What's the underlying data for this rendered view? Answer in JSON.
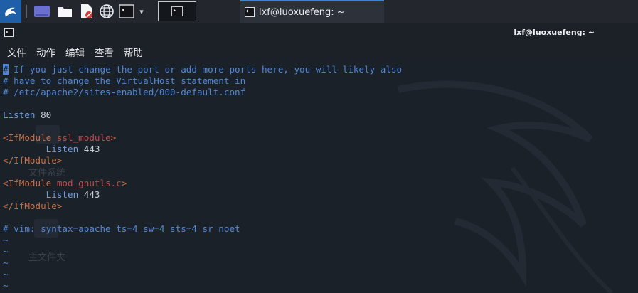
{
  "taskbar": {
    "launchers": [
      "kali-menu-icon",
      "show-desktop-icon",
      "file-manager-icon",
      "text-editor-icon",
      "web-browser-icon",
      "terminal-icon"
    ],
    "dropdown_glyph": "▾",
    "task_title": "lxf@luoxuefeng: ~"
  },
  "window": {
    "title": "lxf@luoxuefeng: ~"
  },
  "menu": [
    "文件",
    "动作",
    "编辑",
    "查看",
    "帮助"
  ],
  "desktop_watermark": {
    "label1": "文件系统",
    "label2": "主文件夹"
  },
  "editor": {
    "lines": [
      [
        {
          "t": "#",
          "c": "cursor"
        },
        {
          "t": " If you just change the port or add more ports here, you will likely also",
          "c": "c-comment"
        }
      ],
      [
        {
          "t": "# have to change the VirtualHost statement in",
          "c": "c-comment"
        }
      ],
      [
        {
          "t": "# /etc/apache2/sites-enabled/000-default.conf",
          "c": "c-comment"
        }
      ],
      [],
      [
        {
          "t": "Listen",
          "c": "c-kw"
        },
        {
          "t": " 80",
          "c": "c-num"
        }
      ],
      [],
      [
        {
          "t": "<IfModule",
          "c": "c-tag"
        },
        {
          "t": " ssl_module",
          "c": "c-mod"
        },
        {
          "t": ">",
          "c": "c-tag"
        }
      ],
      [
        {
          "t": "        Listen",
          "c": "c-kw"
        },
        {
          "t": " 443",
          "c": "c-num"
        }
      ],
      [
        {
          "t": "</IfModule>",
          "c": "c-tag"
        }
      ],
      [],
      [
        {
          "t": "<IfModule",
          "c": "c-tag"
        },
        {
          "t": " mod_gnutls.c",
          "c": "c-mod"
        },
        {
          "t": ">",
          "c": "c-tag"
        }
      ],
      [
        {
          "t": "        Listen",
          "c": "c-kw"
        },
        {
          "t": " 443",
          "c": "c-num"
        }
      ],
      [
        {
          "t": "</IfModule>",
          "c": "c-tag"
        }
      ],
      [],
      [
        {
          "t": "# vim: syntax=apache ts=4 sw=4 sts=4 sr noet",
          "c": "c-comment"
        }
      ],
      [
        {
          "t": "~",
          "c": "c-tilde"
        }
      ],
      [
        {
          "t": "~",
          "c": "c-tilde"
        }
      ],
      [
        {
          "t": "~",
          "c": "c-tilde"
        }
      ],
      [
        {
          "t": "~",
          "c": "c-tilde"
        }
      ],
      [
        {
          "t": "~",
          "c": "c-tilde"
        }
      ]
    ]
  },
  "colors": {
    "background": "#1b2129",
    "comment": "#4f86d8",
    "tag": "#c8714a",
    "module": "#c24a4a",
    "accent": "#3f84d3"
  }
}
